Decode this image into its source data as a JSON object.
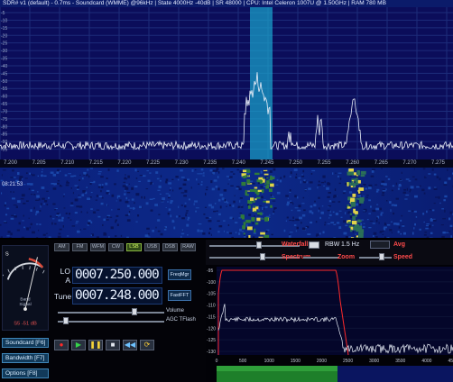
{
  "title_bar": {
    "text": "SDR# v1 (default) ‑ 0.7ms ‑ Soundcard (WMME) @96kHz | State 4000Hz ‑40dB | SR 48000 | CPU: Intel Celeron 1007U @ 1.50GHz | RAM 780 MB"
  },
  "spectrum": {
    "y_ticks": [
      "-5",
      "-10",
      "-15",
      "-20",
      "-25",
      "-30",
      "-35",
      "-40",
      "-45",
      "-50",
      "-55",
      "-60",
      "-65",
      "-70",
      "-75",
      "-80",
      "-85",
      "-90",
      "-95"
    ],
    "colors": {
      "background": "#0b0d5a",
      "grid": "#1c2d7a",
      "trace": "#e8eef8",
      "filter": "#1aa6cf"
    }
  },
  "frequency_scale": {
    "ticks": [
      "7.200",
      "7.205",
      "7.210",
      "7.215",
      "7.220",
      "7.225",
      "7.230",
      "7.235",
      "7.240",
      "7.245",
      "7.250",
      "7.255",
      "7.260",
      "7.265",
      "7.270",
      "7.275"
    ]
  },
  "waterfall": {
    "timestamp": "08:21:53"
  },
  "s_meter": {
    "title": "S",
    "label_top": "Band",
    "label_bottom": "Signal",
    "reading": "S5 ‑51 dB"
  },
  "side_buttons": [
    {
      "label": "Soundcard [F6]"
    },
    {
      "label": "Bandwidth [F7]"
    },
    {
      "label": "Options [F8]"
    }
  ],
  "modes": [
    {
      "label": "AM",
      "active": false
    },
    {
      "label": "FM",
      "active": false
    },
    {
      "label": "WFM",
      "active": false
    },
    {
      "label": "CW",
      "active": false
    },
    {
      "label": "LSB",
      "active": true
    },
    {
      "label": "USB",
      "active": false
    },
    {
      "label": "DSB",
      "active": false
    },
    {
      "label": "RAW",
      "active": false
    }
  ],
  "lo": {
    "label": "LO A",
    "value": "0007.250.000"
  },
  "tune": {
    "label": "Tune",
    "value": "0007.248.000"
  },
  "buttons": {
    "freqmgr": "FreqMgr",
    "fastfft": "FastFFT"
  },
  "volume": {
    "label": "Volume",
    "level": 0.73
  },
  "filter": {
    "label": "AGC TFlash",
    "level": 0.05
  },
  "waterfall_controls": {
    "waterfall_label": "Waterfall",
    "rbw_label": "RBW",
    "rbw_value": "1.5 Hz",
    "avg_label": "Avg",
    "spectrum_label": "Spectrum",
    "zoom_label": "Zoom",
    "speed_label": "Speed"
  },
  "audio_spectrum": {
    "y_ticks": [
      "-95",
      "-100",
      "-105",
      "-110",
      "-115",
      "-120",
      "-125",
      "-130"
    ],
    "x_ticks": [
      "0",
      "500",
      "1000",
      "1500",
      "2000",
      "2500",
      "3000",
      "3500",
      "4000",
      "4500"
    ],
    "colors": {
      "background": "#04062a",
      "filter_line": "#ff2a2a",
      "trace": "#e8eef8"
    }
  }
}
